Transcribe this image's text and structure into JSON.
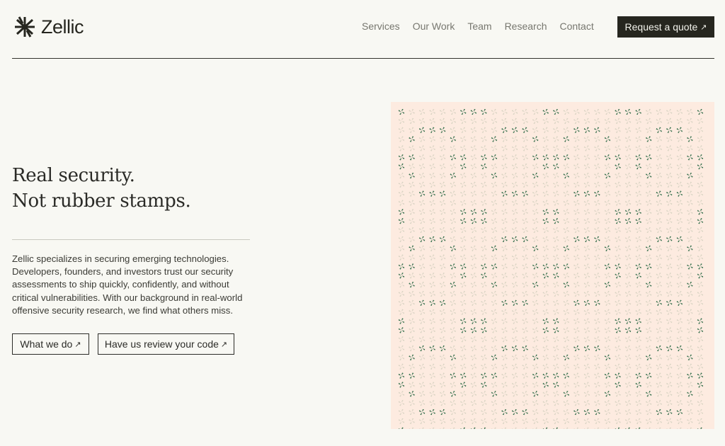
{
  "brand": {
    "name": "Zellic",
    "logo_icon": "zellic-star-logo"
  },
  "nav": {
    "items": [
      "Services",
      "Our Work",
      "Team",
      "Research",
      "Contact"
    ]
  },
  "header": {
    "quote_label": "Request a quote",
    "quote_icon": "arrow-up-right-icon"
  },
  "hero": {
    "headline_line1": "Real security.",
    "headline_line2": "Not rubber stamps.",
    "description": "Zellic specializes in securing emerging technologies. Developers, founders, and investors trust our security assessments to ship quickly, confidently, and without critical vulnerabilities. With our background in real-world offensive security research, we find what others miss.",
    "primary_label": "What we do",
    "secondary_label": "Have us review your code",
    "button_icon": "arrow-up-right-icon"
  },
  "colors": {
    "background": "#f8f8f3",
    "text": "#2b2b27",
    "nav_text": "#77776f",
    "button_dark": "#26261f",
    "pattern_bg": "#fdebe0",
    "pattern_active": "#2f6b47",
    "pattern_faint": "#d8d3c2"
  },
  "pattern": {
    "icon": "pinwheel-icon"
  }
}
